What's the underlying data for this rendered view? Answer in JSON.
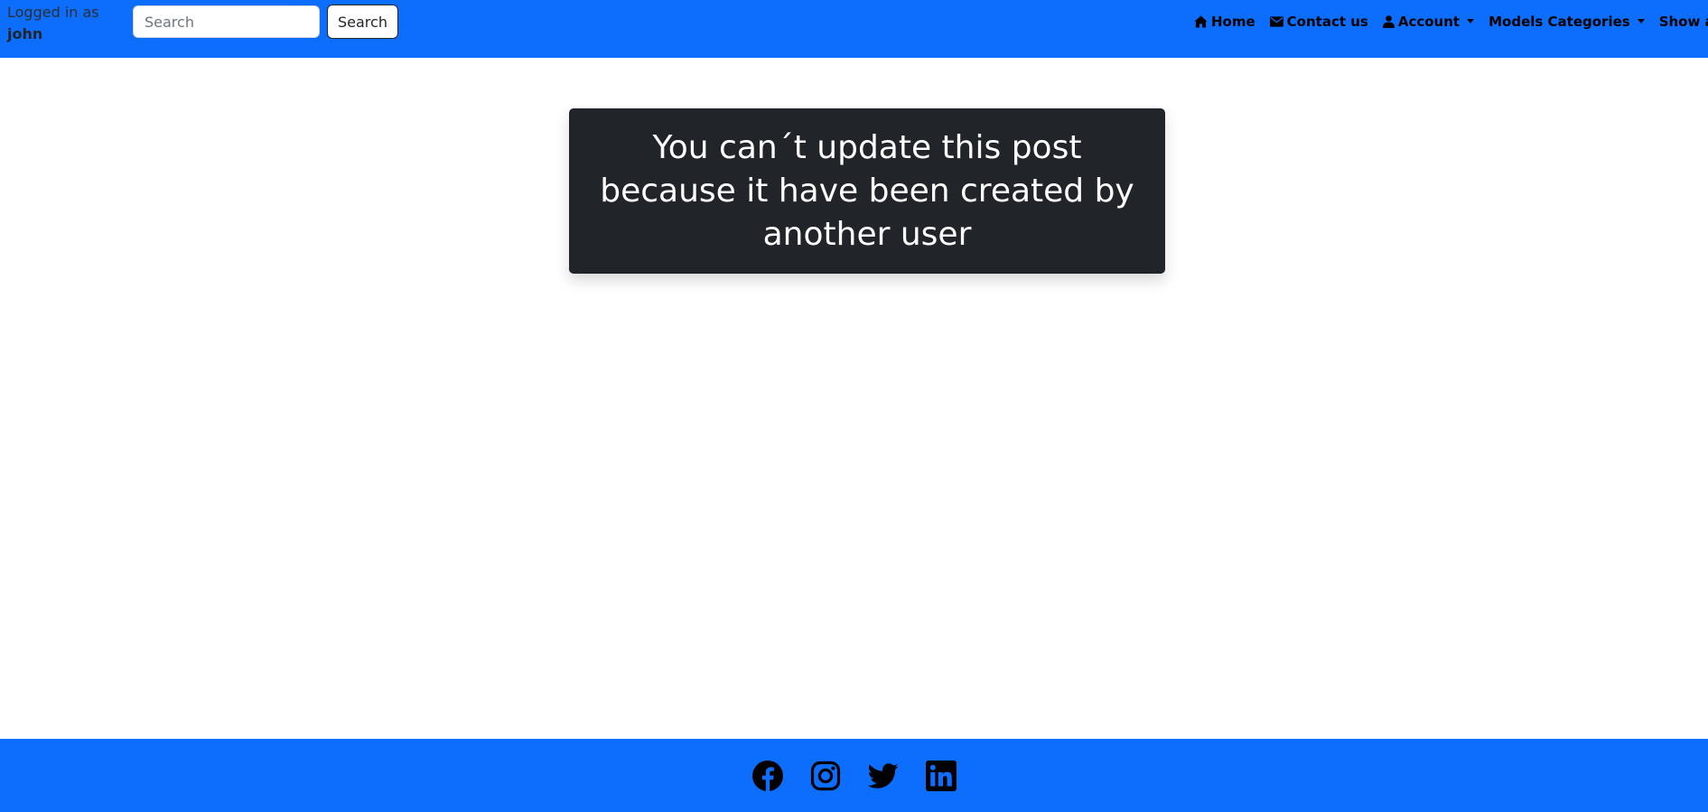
{
  "navbar": {
    "background_color": "#0d6efd",
    "user": {
      "logged_in_text": "Logged in as",
      "username": "john"
    },
    "search": {
      "placeholder": "Search",
      "value": "",
      "button_label": "Search"
    },
    "links": [
      {
        "label": "Home",
        "icon": "home-icon"
      },
      {
        "label": "Contact us",
        "icon": "envelope-icon"
      },
      {
        "label": "Account",
        "icon": "user-icon",
        "dropdown": true
      },
      {
        "label": "Models Categories",
        "dropdown": true
      },
      {
        "label": "Show all review"
      }
    ]
  },
  "alert": {
    "message": "You can´t update this post because it have been created by another user",
    "background_color": "#212529"
  },
  "footer": {
    "background_color": "#0d6efd",
    "social_icons": [
      "facebook-icon",
      "instagram-icon",
      "twitter-icon",
      "linkedin-icon"
    ]
  }
}
